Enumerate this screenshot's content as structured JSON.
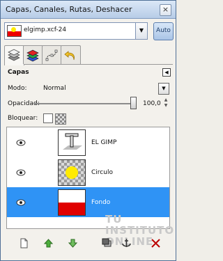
{
  "window": {
    "title": "Capas, Canales, Rutas, Deshacer",
    "close_glyph": "×"
  },
  "image_menu": {
    "name": "elgimp.xcf-24",
    "auto_label": "Auto"
  },
  "panel": {
    "title": "Capas",
    "menu_glyph": "◀"
  },
  "mode": {
    "label": "Modo:",
    "value": "Normal"
  },
  "opacity": {
    "label": "Opacidad:",
    "value": "100,0",
    "level": 1.0
  },
  "lock": {
    "label": "Bloquear:"
  },
  "layers": [
    {
      "name": "EL GIMP",
      "visible": true,
      "thumbnail": "text-layer"
    },
    {
      "name": "Circulo",
      "visible": true,
      "thumbnail": "yellow-circle-transparent"
    },
    {
      "name": "Fondo",
      "visible": true,
      "thumbnail": "white-red-background",
      "selected": true
    }
  ],
  "watermark": {
    "line1": "TU",
    "line2": "INSTITUTO",
    "line3": "ONLINE"
  },
  "colors": {
    "selection": "#2f93f5",
    "layer_red": "#e00000",
    "circle_yellow": "#ffeb00",
    "titlebar": "#b7cce7"
  },
  "bottom_tools": [
    "new-layer-icon",
    "raise-layer-icon",
    "lower-layer-icon",
    "duplicate-layer-icon",
    "anchor-layer-icon",
    "delete-layer-icon"
  ]
}
